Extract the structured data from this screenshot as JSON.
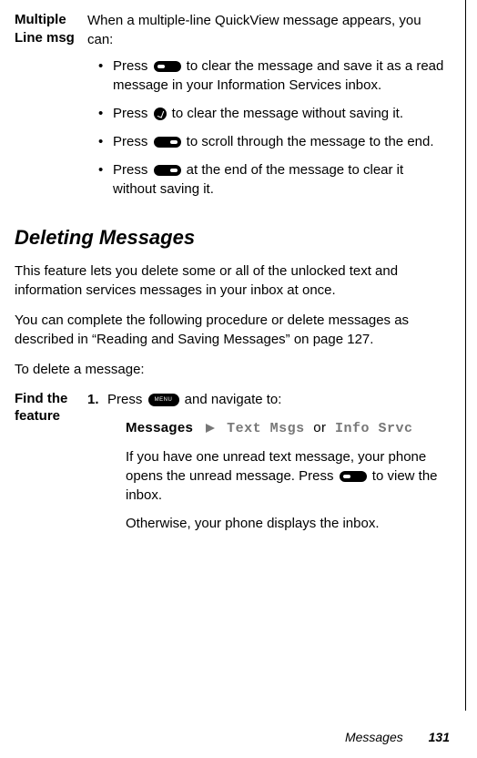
{
  "multiLineMsg": {
    "label": "Multiple Line msg",
    "intro": "When a multiple-line QuickView message appears, you can:",
    "bullets": {
      "b1a": "Press ",
      "b1b": " to clear the message and save it as a read message in your Information Services inbox.",
      "b2a": "Press ",
      "b2b": " to clear the message without saving it.",
      "b3a": "Press ",
      "b3b": " to scroll through the message to the end.",
      "b4a": "Press ",
      "b4b": " at the end of the message to clear it without saving it."
    }
  },
  "deleting": {
    "title": "Deleting Messages",
    "p1": "This feature lets you delete some or all of the unlocked text and information services messages in your inbox at once.",
    "p2": "You can complete the following procedure or delete messages as described in “Reading and Saving Messages” on page 127.",
    "p3": "To delete a message:",
    "feature": {
      "label": "Find the feature",
      "stepNum": "1.",
      "stepA": "Press ",
      "stepB": " and navigate to:",
      "navMessages": "Messages",
      "navOr": "or",
      "navText": "Text Msgs",
      "navInfo": "Info Srvc",
      "sub1a": "If you have one unread text message, your phone opens the unread message. Press ",
      "sub1b": " to view the inbox.",
      "sub2": "Otherwise, your phone displays the inbox."
    }
  },
  "footer": {
    "section": "Messages",
    "page": "131"
  },
  "menuLabel": "MENU"
}
